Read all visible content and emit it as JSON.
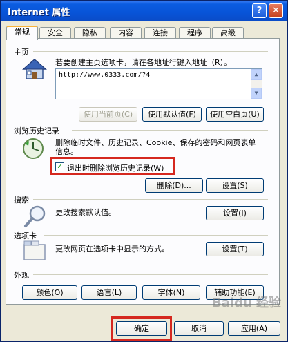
{
  "window": {
    "title": "Internet 属性",
    "help_glyph": "?",
    "close_glyph": "✕"
  },
  "tabs": [
    "常规",
    "安全",
    "隐私",
    "内容",
    "连接",
    "程序",
    "高级"
  ],
  "homepage": {
    "section": "主页",
    "description": "若要创建主页选项卡，请在各地址行键入地址（R）。",
    "url": "http://www.0333.com/?4",
    "buttons": [
      "使用当前页(C)",
      "使用默认值(F)",
      "使用空白页(U)"
    ]
  },
  "history": {
    "section": "浏览历史记录",
    "description": "删除临时文件、历史记录、Cookie、保存的密码和网页表单信息。",
    "checkbox_label": "退出时删除浏览历史记录(W)",
    "checkbox_checked": true,
    "delete_button": "删除(D)...",
    "settings_button": "设置(S)"
  },
  "search": {
    "section": "搜索",
    "description": "更改搜索默认值。",
    "settings_button": "设置(I)"
  },
  "tabs_section": {
    "section": "选项卡",
    "description": "更改网页在选项卡中显示的方式。",
    "settings_button": "设置(T)"
  },
  "appearance": {
    "section": "外观",
    "buttons": [
      "颜色(O)",
      "语言(L)",
      "字体(N)",
      "辅助功能(E)"
    ]
  },
  "footer": {
    "ok": "确定",
    "cancel": "取消",
    "apply": "应用(A)"
  },
  "watermark": "Baidu 经验",
  "colors": {
    "highlight": "#d5281f",
    "titlebar": "#0854d8"
  }
}
